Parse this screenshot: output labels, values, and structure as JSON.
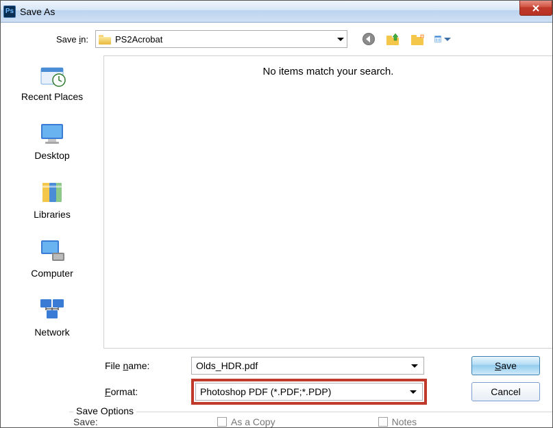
{
  "window": {
    "title": "Save As"
  },
  "toolbar": {
    "savein_label_pre": "Save ",
    "savein_label_u": "i",
    "savein_label_post": "n:",
    "savein_value": "PS2Acrobat"
  },
  "sidebar": {
    "items": [
      {
        "label": "Recent Places"
      },
      {
        "label": "Desktop"
      },
      {
        "label": "Libraries"
      },
      {
        "label": "Computer"
      },
      {
        "label": "Network"
      }
    ]
  },
  "filelist": {
    "empty_message": "No items match your search."
  },
  "form": {
    "filename_label_pre": "File ",
    "filename_label_u": "n",
    "filename_label_post": "ame:",
    "filename_value": "Olds_HDR.pdf",
    "format_label_u": "F",
    "format_label_post": "ormat:",
    "format_value": "Photoshop PDF (*.PDF;*.PDP)"
  },
  "buttons": {
    "save": "Save",
    "cancel": "Cancel"
  },
  "options": {
    "legend": "Save Options",
    "save_label": "Save:",
    "as_copy": "As a Copy",
    "notes": "Notes"
  }
}
